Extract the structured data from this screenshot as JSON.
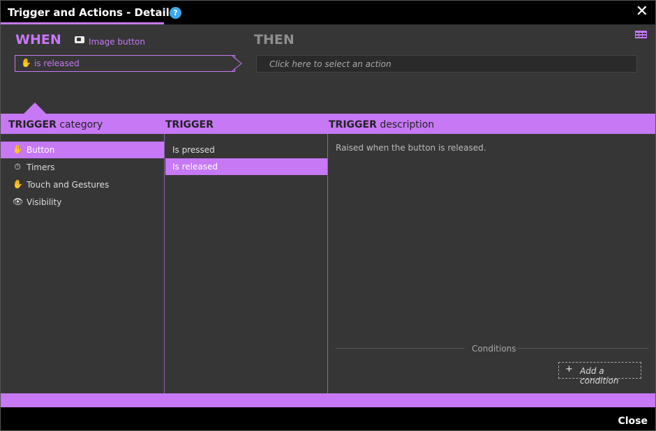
{
  "window": {
    "title": "Trigger and Actions - Details",
    "help": "?",
    "close_x": "✕"
  },
  "when": {
    "label": "WHEN",
    "source_icon": "image-button-icon",
    "source_label": "Image button",
    "trigger_text": "is released"
  },
  "then": {
    "label": "THEN",
    "action_placeholder": "Click here to select an action"
  },
  "headers": {
    "category_strong": "TRIGGER",
    "category_rest": " category",
    "trigger": "TRIGGER",
    "desc_strong": "TRIGGER",
    "desc_rest": " description"
  },
  "categories": [
    {
      "label": "Button",
      "icon": "hand-icon",
      "glyph": "✋",
      "selected": true
    },
    {
      "label": "Timers",
      "icon": "timer-icon",
      "glyph": "⏱",
      "selected": false
    },
    {
      "label": "Touch and Gestures",
      "icon": "hand-icon",
      "glyph": "✋",
      "selected": false
    },
    {
      "label": "Visibility",
      "icon": "eye-icon",
      "glyph": "👁",
      "selected": false
    }
  ],
  "triggers": [
    {
      "label": "Is pressed",
      "selected": false
    },
    {
      "label": "Is released",
      "selected": true
    }
  ],
  "description": "Raised when the button is released.",
  "conditions": {
    "label": "Conditions",
    "add_label": "Add a condition",
    "plus": "+"
  },
  "footer": {
    "close_label": "Close"
  },
  "colors": {
    "accent": "#c678f5",
    "help_blue": "#3aa8ef",
    "panel": "#363636"
  }
}
